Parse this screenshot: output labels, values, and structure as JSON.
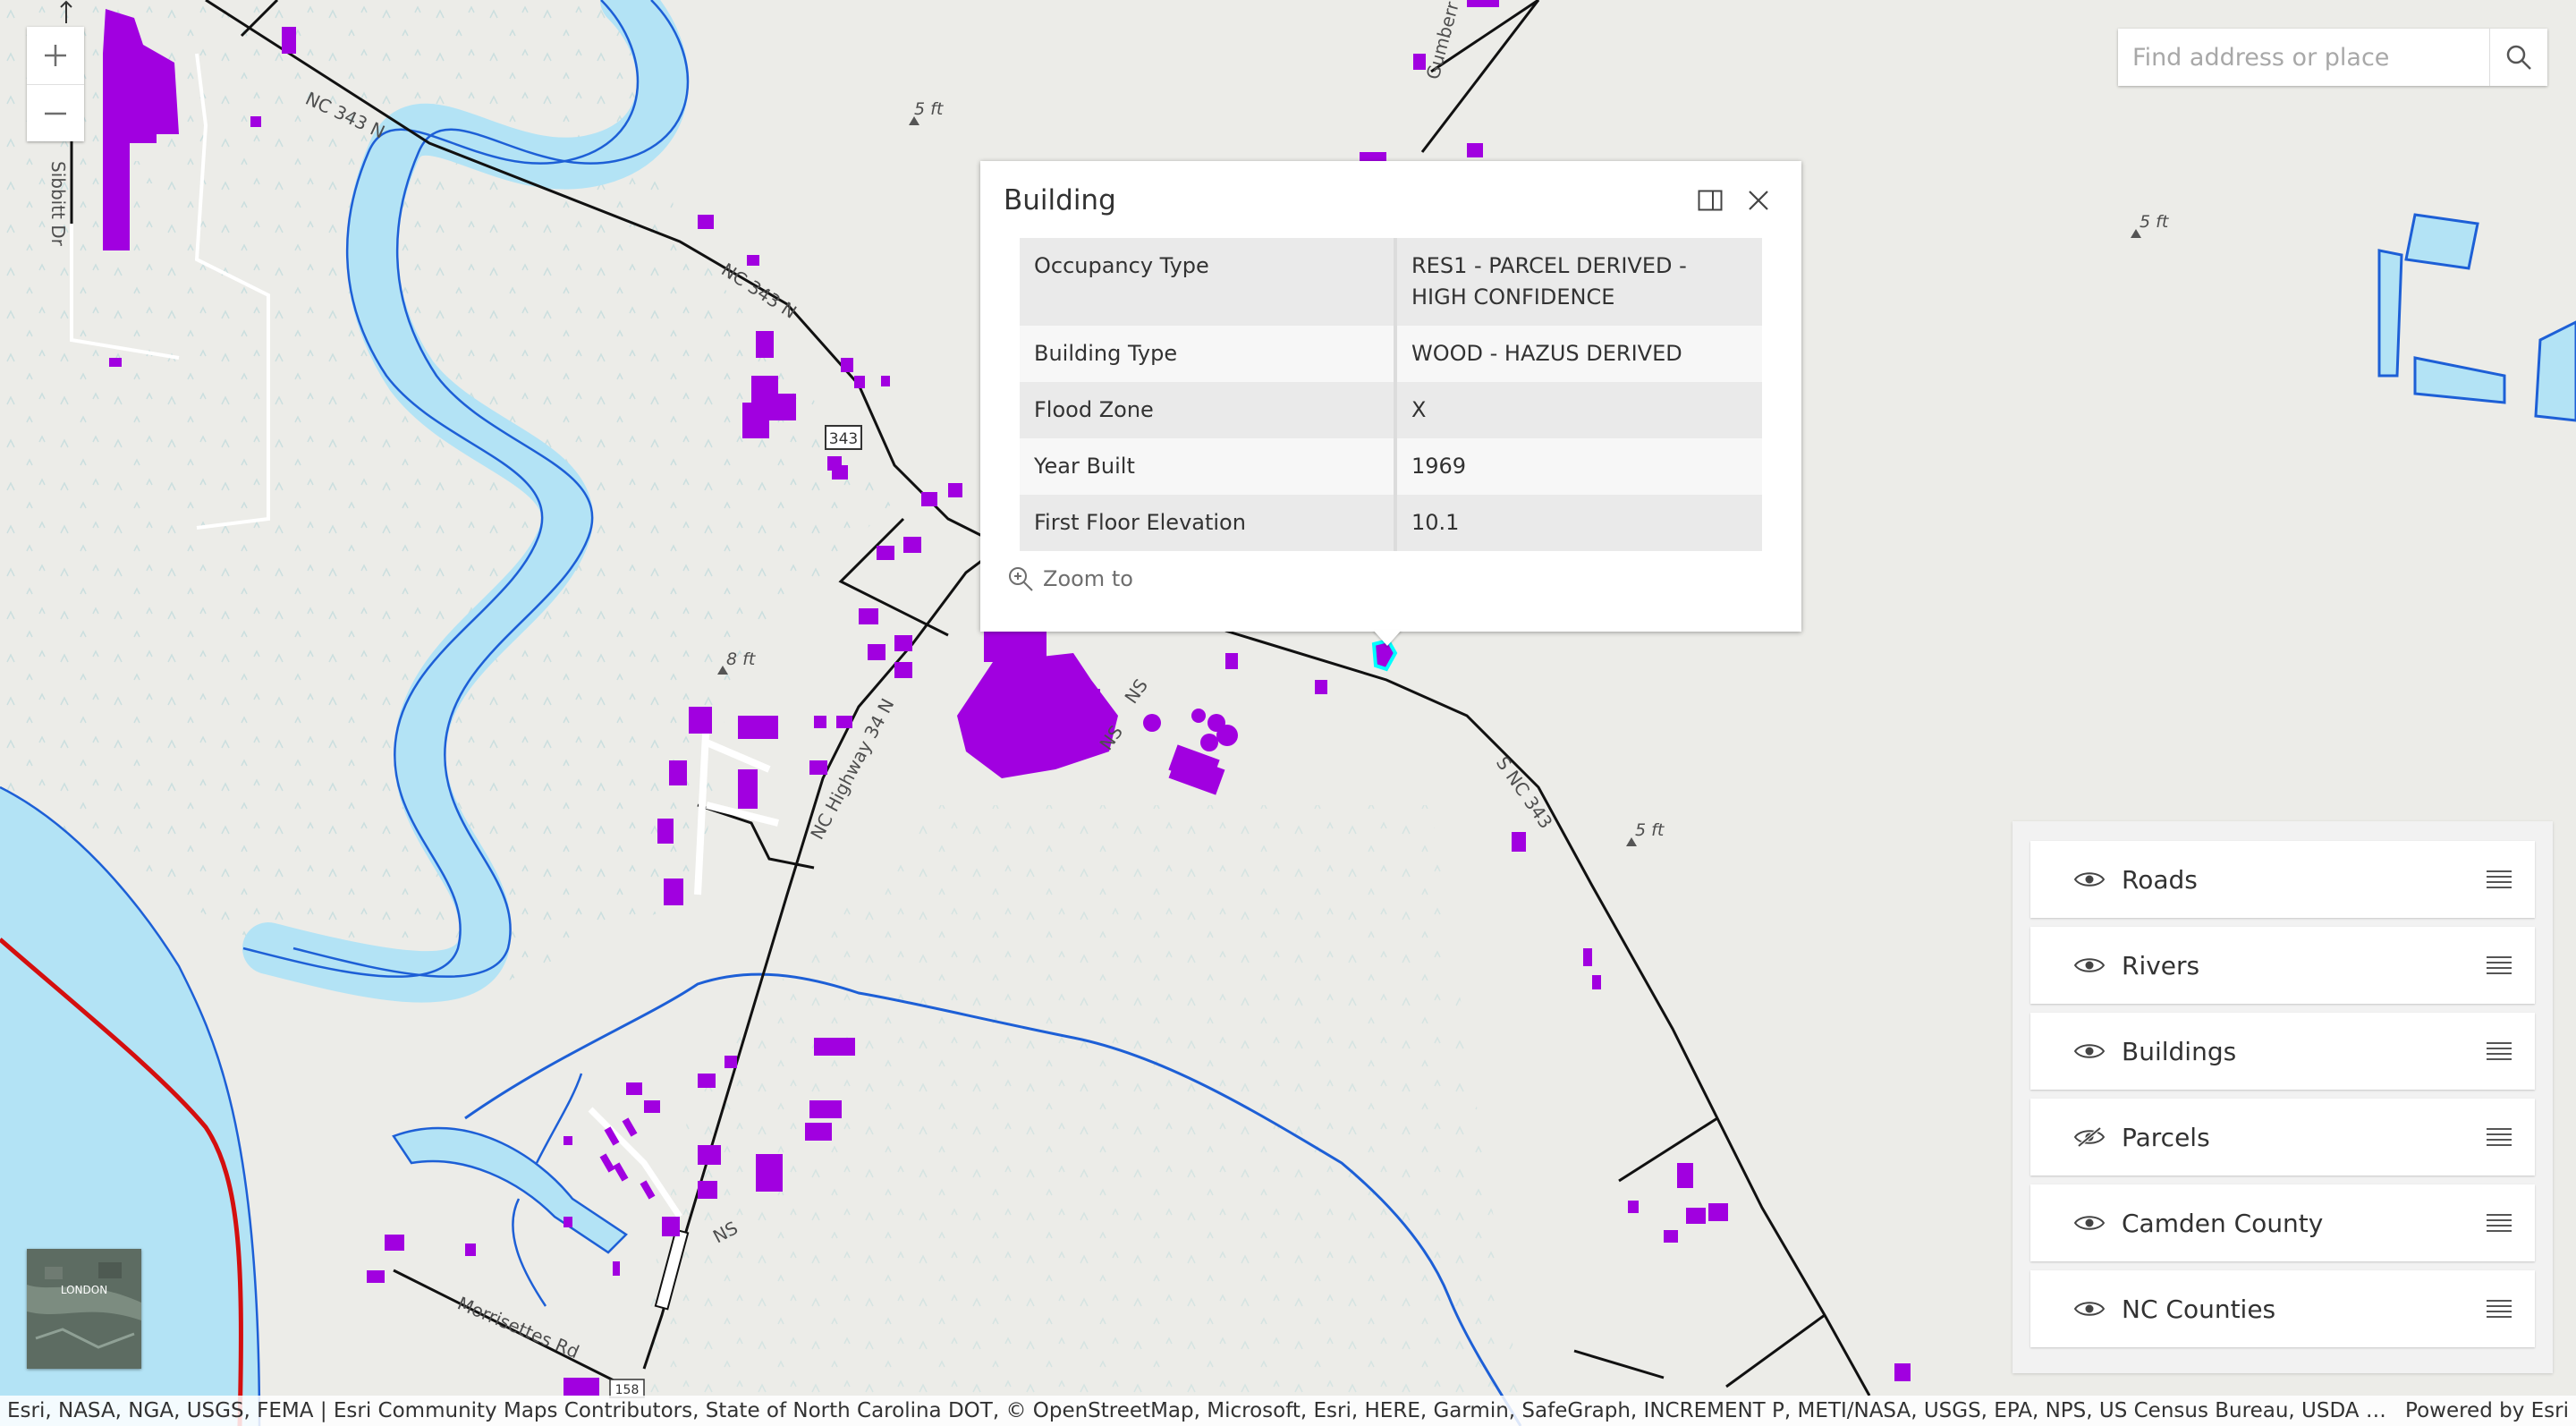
{
  "map": {
    "labels": {
      "nc343_a": "NC 343 N",
      "nc343_b": "NC 343 N",
      "nc343_shield": "343",
      "nc34": "NC Highway 34 N",
      "ns_a": "NS",
      "ns_b": "NS",
      "ns_c": "NS",
      "s_nc343": "S NC 343",
      "morrisettes": "Morrisettes Rd",
      "sibbitt": "Sibbitt Dr",
      "gumberry": "Gumberr",
      "shield_158": "158",
      "elev1": "5 ft",
      "elev2": "5 ft",
      "elev3": "8 ft",
      "elev4": "5 ft"
    }
  },
  "controls": {
    "zoom_in": "+",
    "zoom_out": "−"
  },
  "search": {
    "placeholder": "Find address or place"
  },
  "popup": {
    "title": "Building",
    "rows": [
      {
        "key": "Occupancy Type",
        "value": "RES1 - PARCEL DERIVED - HIGH CONFIDENCE"
      },
      {
        "key": "Building Type",
        "value": "WOOD - HAZUS DERIVED"
      },
      {
        "key": "Flood Zone",
        "value": "X"
      },
      {
        "key": "Year Built",
        "value": "1969"
      },
      {
        "key": "First Floor Elevation",
        "value": "10.1"
      }
    ],
    "zoom_to": "Zoom to"
  },
  "layers": [
    {
      "name": "Roads",
      "visible": true
    },
    {
      "name": "Rivers",
      "visible": true
    },
    {
      "name": "Buildings",
      "visible": true
    },
    {
      "name": "Parcels",
      "visible": false
    },
    {
      "name": "Camden County",
      "visible": true
    },
    {
      "name": "NC Counties",
      "visible": true
    }
  ],
  "basemap": {
    "thumbnail_label": "LONDON"
  },
  "attribution": {
    "text": "Esri, NASA, NGA, USGS, FEMA | Esri Community Maps Contributors, State of North Carolina DOT, © OpenStreetMap, Microsoft, Esri, HERE, Garmin, SafeGraph, INCREMENT P, METI/NASA, USGS, EPA, NPS, US Census Bureau, USDA | The North...",
    "powered": "Powered by Esri"
  },
  "colors": {
    "water": "#b3e3f5",
    "river_line": "#1d5fd6",
    "road": "#111111",
    "building": "#a100e0",
    "county_line": "#d40f0f",
    "land": "#ecece8"
  }
}
